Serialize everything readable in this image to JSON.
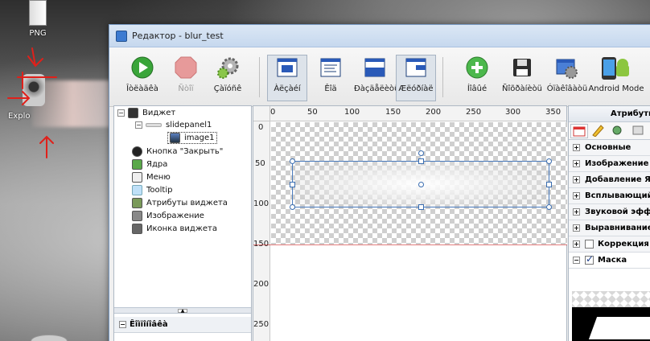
{
  "desktop": {
    "icons": [
      {
        "label": "PNG"
      },
      {
        "label": "Explo"
      }
    ]
  },
  "window": {
    "title": "Редактор - blur_test"
  },
  "toolbar": {
    "buttons": [
      {
        "label": "Îòëàäêà",
        "icon": "play-icon",
        "state": "normal"
      },
      {
        "label": "Ñòîï",
        "icon": "stop-icon",
        "state": "disabled"
      },
      {
        "label": "Çàïóñê",
        "icon": "gears-icon",
        "state": "normal"
      },
      {
        "label": "Àëçàéí",
        "icon": "design-view-icon",
        "state": "pressed"
      },
      {
        "label": "Êîä",
        "icon": "code-view-icon",
        "state": "normal"
      },
      {
        "label": "Ðàçäåëèòü",
        "icon": "split-view-icon",
        "state": "normal"
      },
      {
        "label": "Æëóðíàë",
        "icon": "log-view-icon",
        "state": "pressed"
      },
      {
        "label": "Íîâûé",
        "icon": "new-plus-icon",
        "state": "normal"
      },
      {
        "label": "Ñîõðàíèòü",
        "icon": "save-disk-icon",
        "state": "normal"
      },
      {
        "label": "Óïàêîâàòü",
        "icon": "package-icon",
        "state": "normal"
      },
      {
        "label": "Android Mode",
        "icon": "android-icon",
        "state": "normal"
      }
    ]
  },
  "tree": {
    "items": [
      {
        "label": "Виджет",
        "icon": "widget-icon"
      },
      {
        "label": "slidepanel1",
        "icon": "slidepanel-icon"
      },
      {
        "label": "image1",
        "icon": "image-icon",
        "selected": true
      },
      {
        "label": "Кнопка \"Закрыть\"",
        "icon": "close-button-icon"
      },
      {
        "label": "Ядра",
        "icon": "cores-icon"
      },
      {
        "label": "Меню",
        "icon": "menu-icon"
      },
      {
        "label": "Tooltip",
        "icon": "tooltip-icon"
      },
      {
        "label": "Атрибуты виджета",
        "icon": "attributes-icon"
      },
      {
        "label": "Изображение",
        "icon": "picture-icon"
      },
      {
        "label": "Иконка виджета",
        "icon": "widget-icon-icon"
      }
    ],
    "bottom_header": "Êîìïîíîâêà"
  },
  "rulers": {
    "top": [
      "0",
      "50",
      "100",
      "150",
      "200",
      "250",
      "300",
      "350"
    ],
    "left": [
      "0",
      "50",
      "100",
      "150",
      "200",
      "250"
    ]
  },
  "attributes": {
    "header": "Атрибуты",
    "rows": [
      {
        "label": "Основные",
        "type": "expand"
      },
      {
        "label": "Изображение",
        "type": "expand"
      },
      {
        "label": "Добавление Я",
        "type": "expand"
      },
      {
        "label": "Всплывающий",
        "type": "expand"
      },
      {
        "label": "Звуковой эфф",
        "type": "expand"
      },
      {
        "label": "Выравнивание",
        "type": "expand"
      },
      {
        "label": "Коррекция",
        "type": "check",
        "checked": false
      },
      {
        "label": "Маска",
        "type": "check",
        "checked": true
      }
    ]
  }
}
